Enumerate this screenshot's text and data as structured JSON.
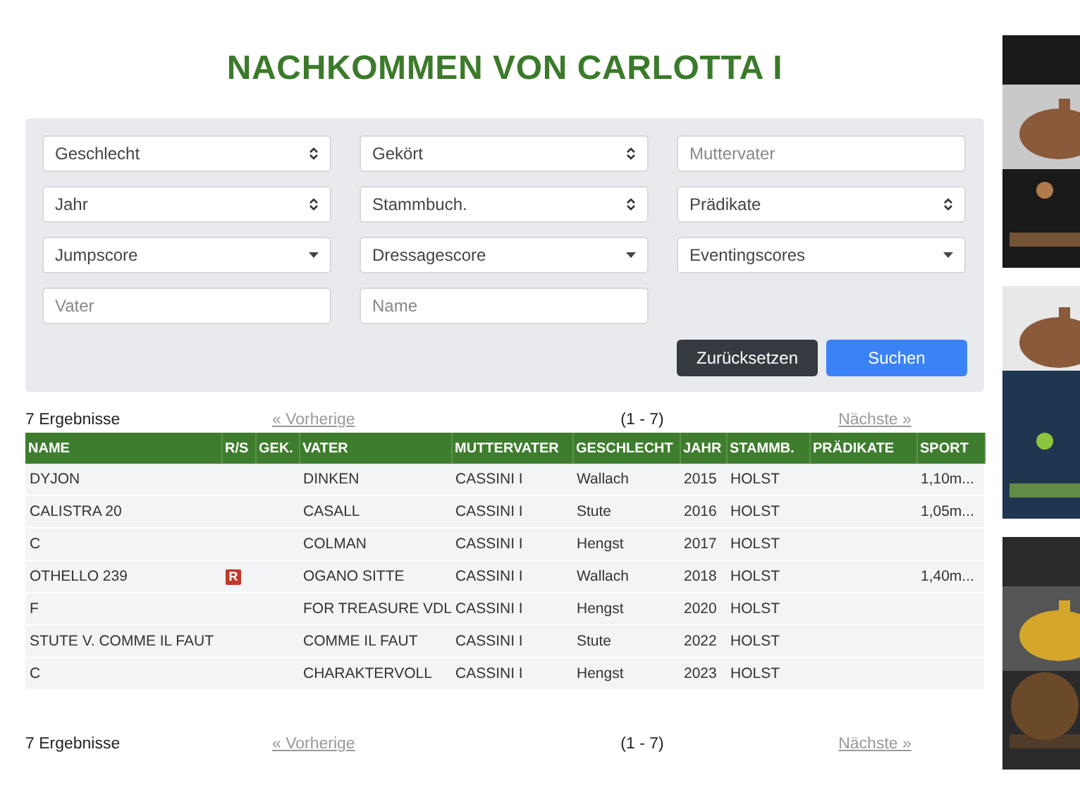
{
  "title": "NACHKOMMEN VON CARLOTTA I",
  "filters": [
    {
      "kind": "select",
      "value": "Geschlecht"
    },
    {
      "kind": "select",
      "value": "Gekört"
    },
    {
      "kind": "text",
      "placeholder": "Muttervater"
    },
    {
      "kind": "select",
      "value": "Jahr"
    },
    {
      "kind": "select",
      "value": "Stammbuch."
    },
    {
      "kind": "select",
      "value": "Prädikate"
    },
    {
      "kind": "dropdown",
      "value": "Jumpscore"
    },
    {
      "kind": "dropdown",
      "value": "Dressagescore"
    },
    {
      "kind": "dropdown",
      "value": "Eventingscores"
    },
    {
      "kind": "text",
      "placeholder": "Vater"
    },
    {
      "kind": "text",
      "placeholder": "Name"
    }
  ],
  "buttons": [
    {
      "kind": "secondary",
      "label": "Zurücksetzen"
    },
    {
      "kind": "primary",
      "label": "Suchen"
    }
  ],
  "pagination_top": {
    "count": "7 Ergebnisse",
    "previous": "«  Vorherige",
    "range": "(1 - 7)",
    "next": "Nächste »"
  },
  "table": {
    "columns": [
      "NAME",
      "R/S",
      "GEK.",
      "VATER",
      "MUTTERVATER",
      "GESCHLECHT",
      "JAHR",
      "STAMMB.",
      "PRÄDIKATE",
      "SPORT"
    ],
    "rows": [
      [
        "DYJON",
        "",
        "",
        "DINKEN",
        "CASSINI I",
        "Wallach",
        "2015",
        "HOLST",
        "",
        "1,10m..."
      ],
      [
        "CALISTRA 20",
        "",
        "",
        "CASALL",
        "CASSINI I",
        "Stute",
        "2016",
        "HOLST",
        "",
        "1,05m..."
      ],
      [
        "C",
        "",
        "",
        "COLMAN",
        "CASSINI I",
        "Hengst",
        "2017",
        "HOLST",
        "",
        ""
      ],
      [
        "OTHELLO 239",
        "R",
        "",
        "OGANO SITTE",
        "CASSINI I",
        "Wallach",
        "2018",
        "HOLST",
        "",
        "1,40m..."
      ],
      [
        "F",
        "",
        "",
        "FOR TREASURE VDL",
        "CASSINI I",
        "Hengst",
        "2020",
        "HOLST",
        "",
        ""
      ],
      [
        "STUTE V. COMME IL FAUT",
        "",
        "",
        "COMME IL FAUT",
        "CASSINI I",
        "Stute",
        "2022",
        "HOLST",
        "",
        ""
      ],
      [
        "C",
        "",
        "",
        "CHARAKTERVOLL",
        "CASSINI I",
        "Hengst",
        "2023",
        "HOLST",
        "",
        ""
      ]
    ]
  },
  "pagination_bottom": {
    "count": "7 Ergebnisse",
    "previous": "«  Vorherige",
    "range": "(1 - 7)",
    "next": "Nächste »"
  }
}
